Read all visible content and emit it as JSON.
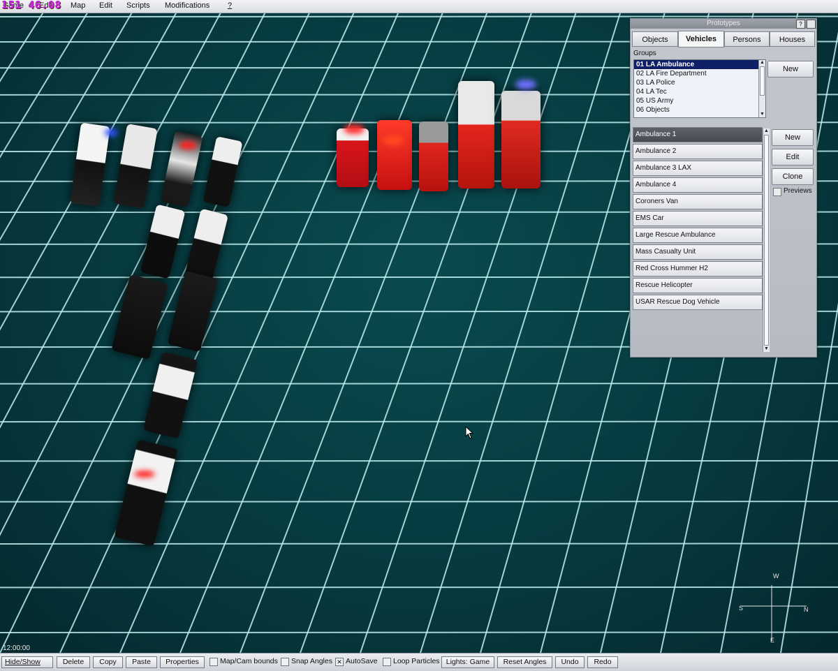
{
  "menubar": {
    "fps": "151 46.08",
    "items": [
      "Game",
      "Edit",
      "Map",
      "Edit",
      "Scripts",
      "Modifications",
      "?"
    ]
  },
  "viewport": {
    "game_time": "12:00:00",
    "compass": {
      "north": "N",
      "south": "S",
      "west": "W",
      "east": "E"
    }
  },
  "prototypes": {
    "title": "Prototypes",
    "help_btn": "?",
    "tabs": [
      "Objects",
      "Vehicles",
      "Persons",
      "Houses"
    ],
    "active_tab": "Vehicles",
    "groups_label": "Groups",
    "groups": [
      "01 LA Ambulance",
      "02 LA Fire Department",
      "03 LA Police",
      "04 LA Tec",
      "05 US Army",
      "06 Objects"
    ],
    "selected_group": "01 LA Ambulance",
    "group_new_button": "New",
    "items": [
      "Ambulance 1",
      "Ambulance 2",
      "Ambulance 3 LAX",
      "Ambulance 4",
      "Coroners Van",
      "EMS Car",
      "Large Rescue Ambulance",
      "Mass Casualty Unit",
      "Red Cross Hummer H2",
      "Rescue Helicopter",
      "USAR Rescue Dog Vehicle"
    ],
    "selected_item": "Ambulance 1",
    "buttons": {
      "new": "New",
      "edit": "Edit",
      "clone": "Clone"
    },
    "previews_label": "Previews",
    "previews_checked": false
  },
  "toolbar": {
    "hide_show": "Hide/Show",
    "delete": "Delete",
    "copy": "Copy",
    "paste": "Paste",
    "properties": "Properties",
    "map_cam_bounds": "Map/Cam bounds",
    "map_cam_bounds_checked": false,
    "snap_angles": "Snap Angles",
    "snap_angles_checked": false,
    "autosave": "AutoSave",
    "autosave_checked": true,
    "loop_particles": "Loop Particles",
    "loop_particles_checked": false,
    "lights": "Lights: Game",
    "reset_angles": "Reset Angles",
    "undo": "Undo",
    "redo": "Redo"
  },
  "colors": {
    "grid_background": "#063a3f",
    "grid_line": "#bfeff0",
    "selected_group": "#102066",
    "fps_text": "#c61ae0"
  }
}
